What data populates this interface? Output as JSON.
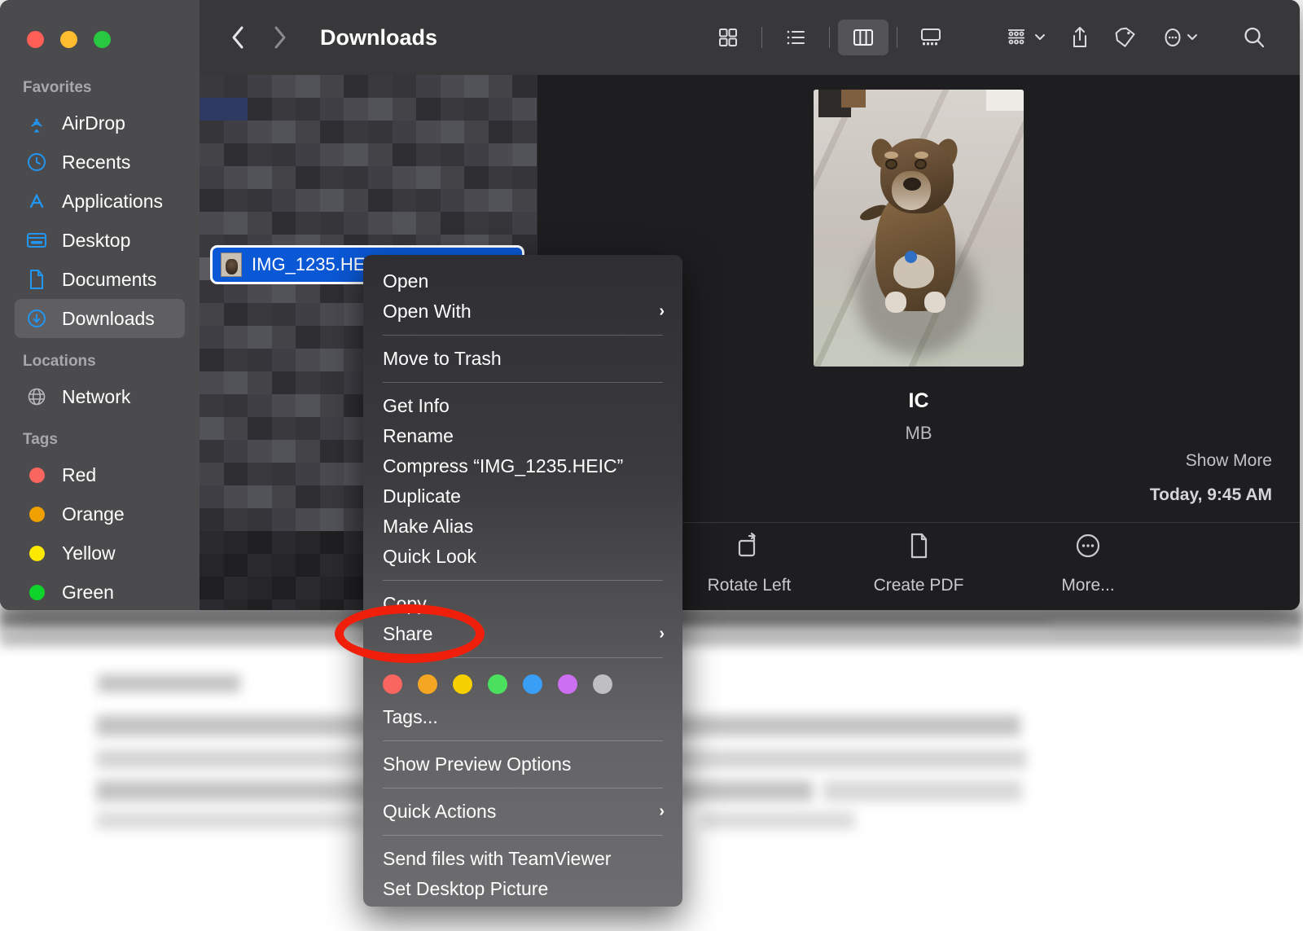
{
  "window": {
    "title": "Downloads",
    "traffic_lights": [
      "close",
      "minimize",
      "zoom"
    ]
  },
  "toolbar": {
    "back_label": "Back",
    "forward_label": "Forward",
    "title": "Downloads",
    "view_icon_grid": "grid-view-icon",
    "view_icon_list": "list-view-icon",
    "view_icon_column": "column-view-icon",
    "view_icon_gallery": "gallery-view-icon",
    "active_view": "column",
    "group_icon": "group-by-icon",
    "share_icon": "share-icon",
    "tags_icon": "tag-icon",
    "more_icon": "more-actions-icon",
    "search_icon": "search-icon"
  },
  "sidebar": {
    "sections": [
      {
        "title": "Favorites",
        "items": [
          {
            "label": "AirDrop",
            "icon": "airdrop-icon",
            "selected": false
          },
          {
            "label": "Recents",
            "icon": "clock-icon",
            "selected": false
          },
          {
            "label": "Applications",
            "icon": "applications-icon",
            "selected": false
          },
          {
            "label": "Desktop",
            "icon": "desktop-icon",
            "selected": false
          },
          {
            "label": "Documents",
            "icon": "document-icon",
            "selected": false
          },
          {
            "label": "Downloads",
            "icon": "downloads-icon",
            "selected": true
          }
        ]
      },
      {
        "title": "Locations",
        "items": [
          {
            "label": "Network",
            "icon": "globe-icon",
            "selected": false
          }
        ]
      },
      {
        "title": "Tags",
        "items": [
          {
            "label": "Red",
            "icon": "tag-dot",
            "color": "#f9655f",
            "selected": false
          },
          {
            "label": "Orange",
            "icon": "tag-dot",
            "color": "#f0a000",
            "selected": false
          },
          {
            "label": "Yellow",
            "icon": "tag-dot",
            "color": "#fbe902",
            "selected": false
          },
          {
            "label": "Green",
            "icon": "tag-dot",
            "color": "#0ed32a",
            "selected": false
          }
        ]
      }
    ]
  },
  "file_list": {
    "selected_file": "IMG_1235.HEIC",
    "selected_icon": "heic-image-thumbnail",
    "note": "other rows pixelated"
  },
  "preview": {
    "image_alt": "dog-photo-preview",
    "filename_visible": "IC",
    "size_visible": "MB",
    "show_more": "Show More",
    "date": "Today, 9:45 AM",
    "actions": [
      {
        "label": "Rotate Left",
        "icon": "rotate-left-icon"
      },
      {
        "label": "Create PDF",
        "icon": "create-pdf-icon"
      },
      {
        "label": "More...",
        "icon": "more-circle-icon"
      }
    ]
  },
  "context_menu": {
    "items": [
      {
        "label": "Open",
        "submenu": false,
        "type": "item"
      },
      {
        "label": "Open With",
        "submenu": true,
        "type": "item"
      },
      {
        "type": "separator"
      },
      {
        "label": "Move to Trash",
        "submenu": false,
        "type": "item"
      },
      {
        "type": "separator"
      },
      {
        "label": "Get Info",
        "submenu": false,
        "type": "item"
      },
      {
        "label": "Rename",
        "submenu": false,
        "type": "item"
      },
      {
        "label": "Compress “IMG_1235.HEIC”",
        "submenu": false,
        "type": "item"
      },
      {
        "label": "Duplicate",
        "submenu": false,
        "type": "item"
      },
      {
        "label": "Make Alias",
        "submenu": false,
        "type": "item"
      },
      {
        "label": "Quick Look",
        "submenu": false,
        "type": "item"
      },
      {
        "type": "separator"
      },
      {
        "label": "Copy",
        "submenu": false,
        "type": "item"
      },
      {
        "label": "Share",
        "submenu": true,
        "type": "item",
        "highlighted": true
      },
      {
        "type": "separator"
      },
      {
        "type": "colors"
      },
      {
        "label": "Tags...",
        "submenu": false,
        "type": "item"
      },
      {
        "type": "separator"
      },
      {
        "label": "Show Preview Options",
        "submenu": false,
        "type": "item"
      },
      {
        "type": "separator"
      },
      {
        "label": "Quick Actions",
        "submenu": true,
        "type": "item"
      },
      {
        "type": "separator"
      },
      {
        "label": "Send files with TeamViewer",
        "submenu": false,
        "type": "item"
      },
      {
        "label": "Set Desktop Picture",
        "submenu": false,
        "type": "item"
      }
    ],
    "tag_colors": [
      "#f9655f",
      "#f5a623",
      "#f7d002",
      "#4ce05f",
      "#3b9ef5",
      "#cc6ff0",
      "#bfbfc2"
    ],
    "submenu_chevron": "›"
  },
  "annotation": {
    "type": "ellipse",
    "color": "#f01f0b",
    "target": "Share"
  }
}
